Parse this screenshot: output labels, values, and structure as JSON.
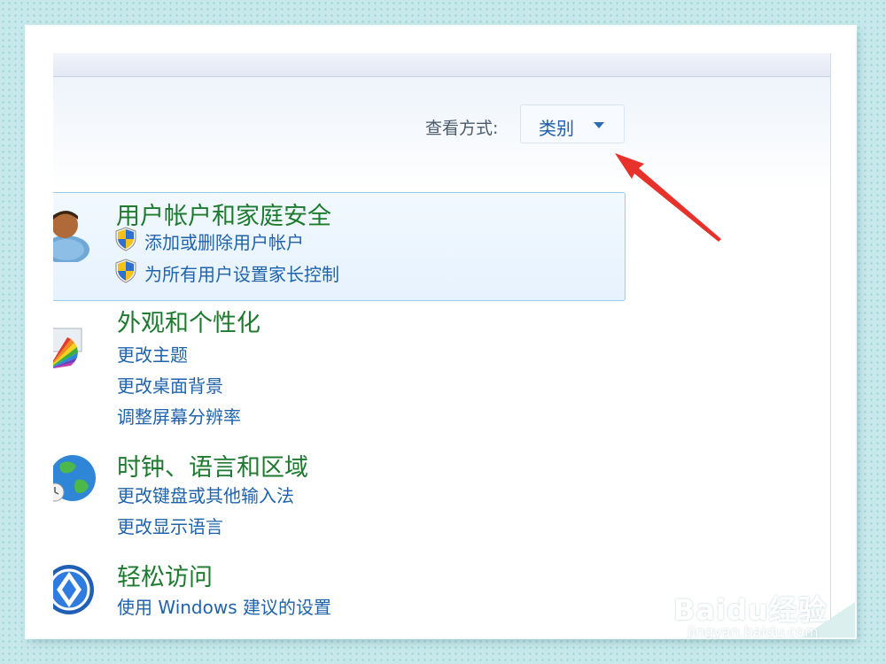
{
  "view": {
    "label": "查看方式:",
    "value": "类别"
  },
  "categories": [
    {
      "title": "用户帐户和家庭安全",
      "icon": "user-accounts-icon",
      "links": [
        "添加或删除用户帐户",
        "为所有用户设置家长控制"
      ]
    },
    {
      "title": "外观和个性化",
      "icon": "appearance-palette-icon",
      "links": [
        "更改主题",
        "更改桌面背景",
        "调整屏幕分辨率"
      ]
    },
    {
      "title": "时钟、语言和区域",
      "icon": "globe-clock-icon",
      "links": [
        "更改键盘或其他输入法",
        "更改显示语言"
      ]
    },
    {
      "title": "轻松访问",
      "icon": "ease-of-access-icon",
      "links": [
        "使用 Windows 建议的设置"
      ]
    }
  ],
  "watermark": {
    "brand": "Baidu经验",
    "url": "jingyan.baidu.com"
  },
  "colors": {
    "category": "#1e7a2f",
    "link": "#1f63ac",
    "highlight": "#e6f2fd",
    "arrow": "#e8312b"
  }
}
